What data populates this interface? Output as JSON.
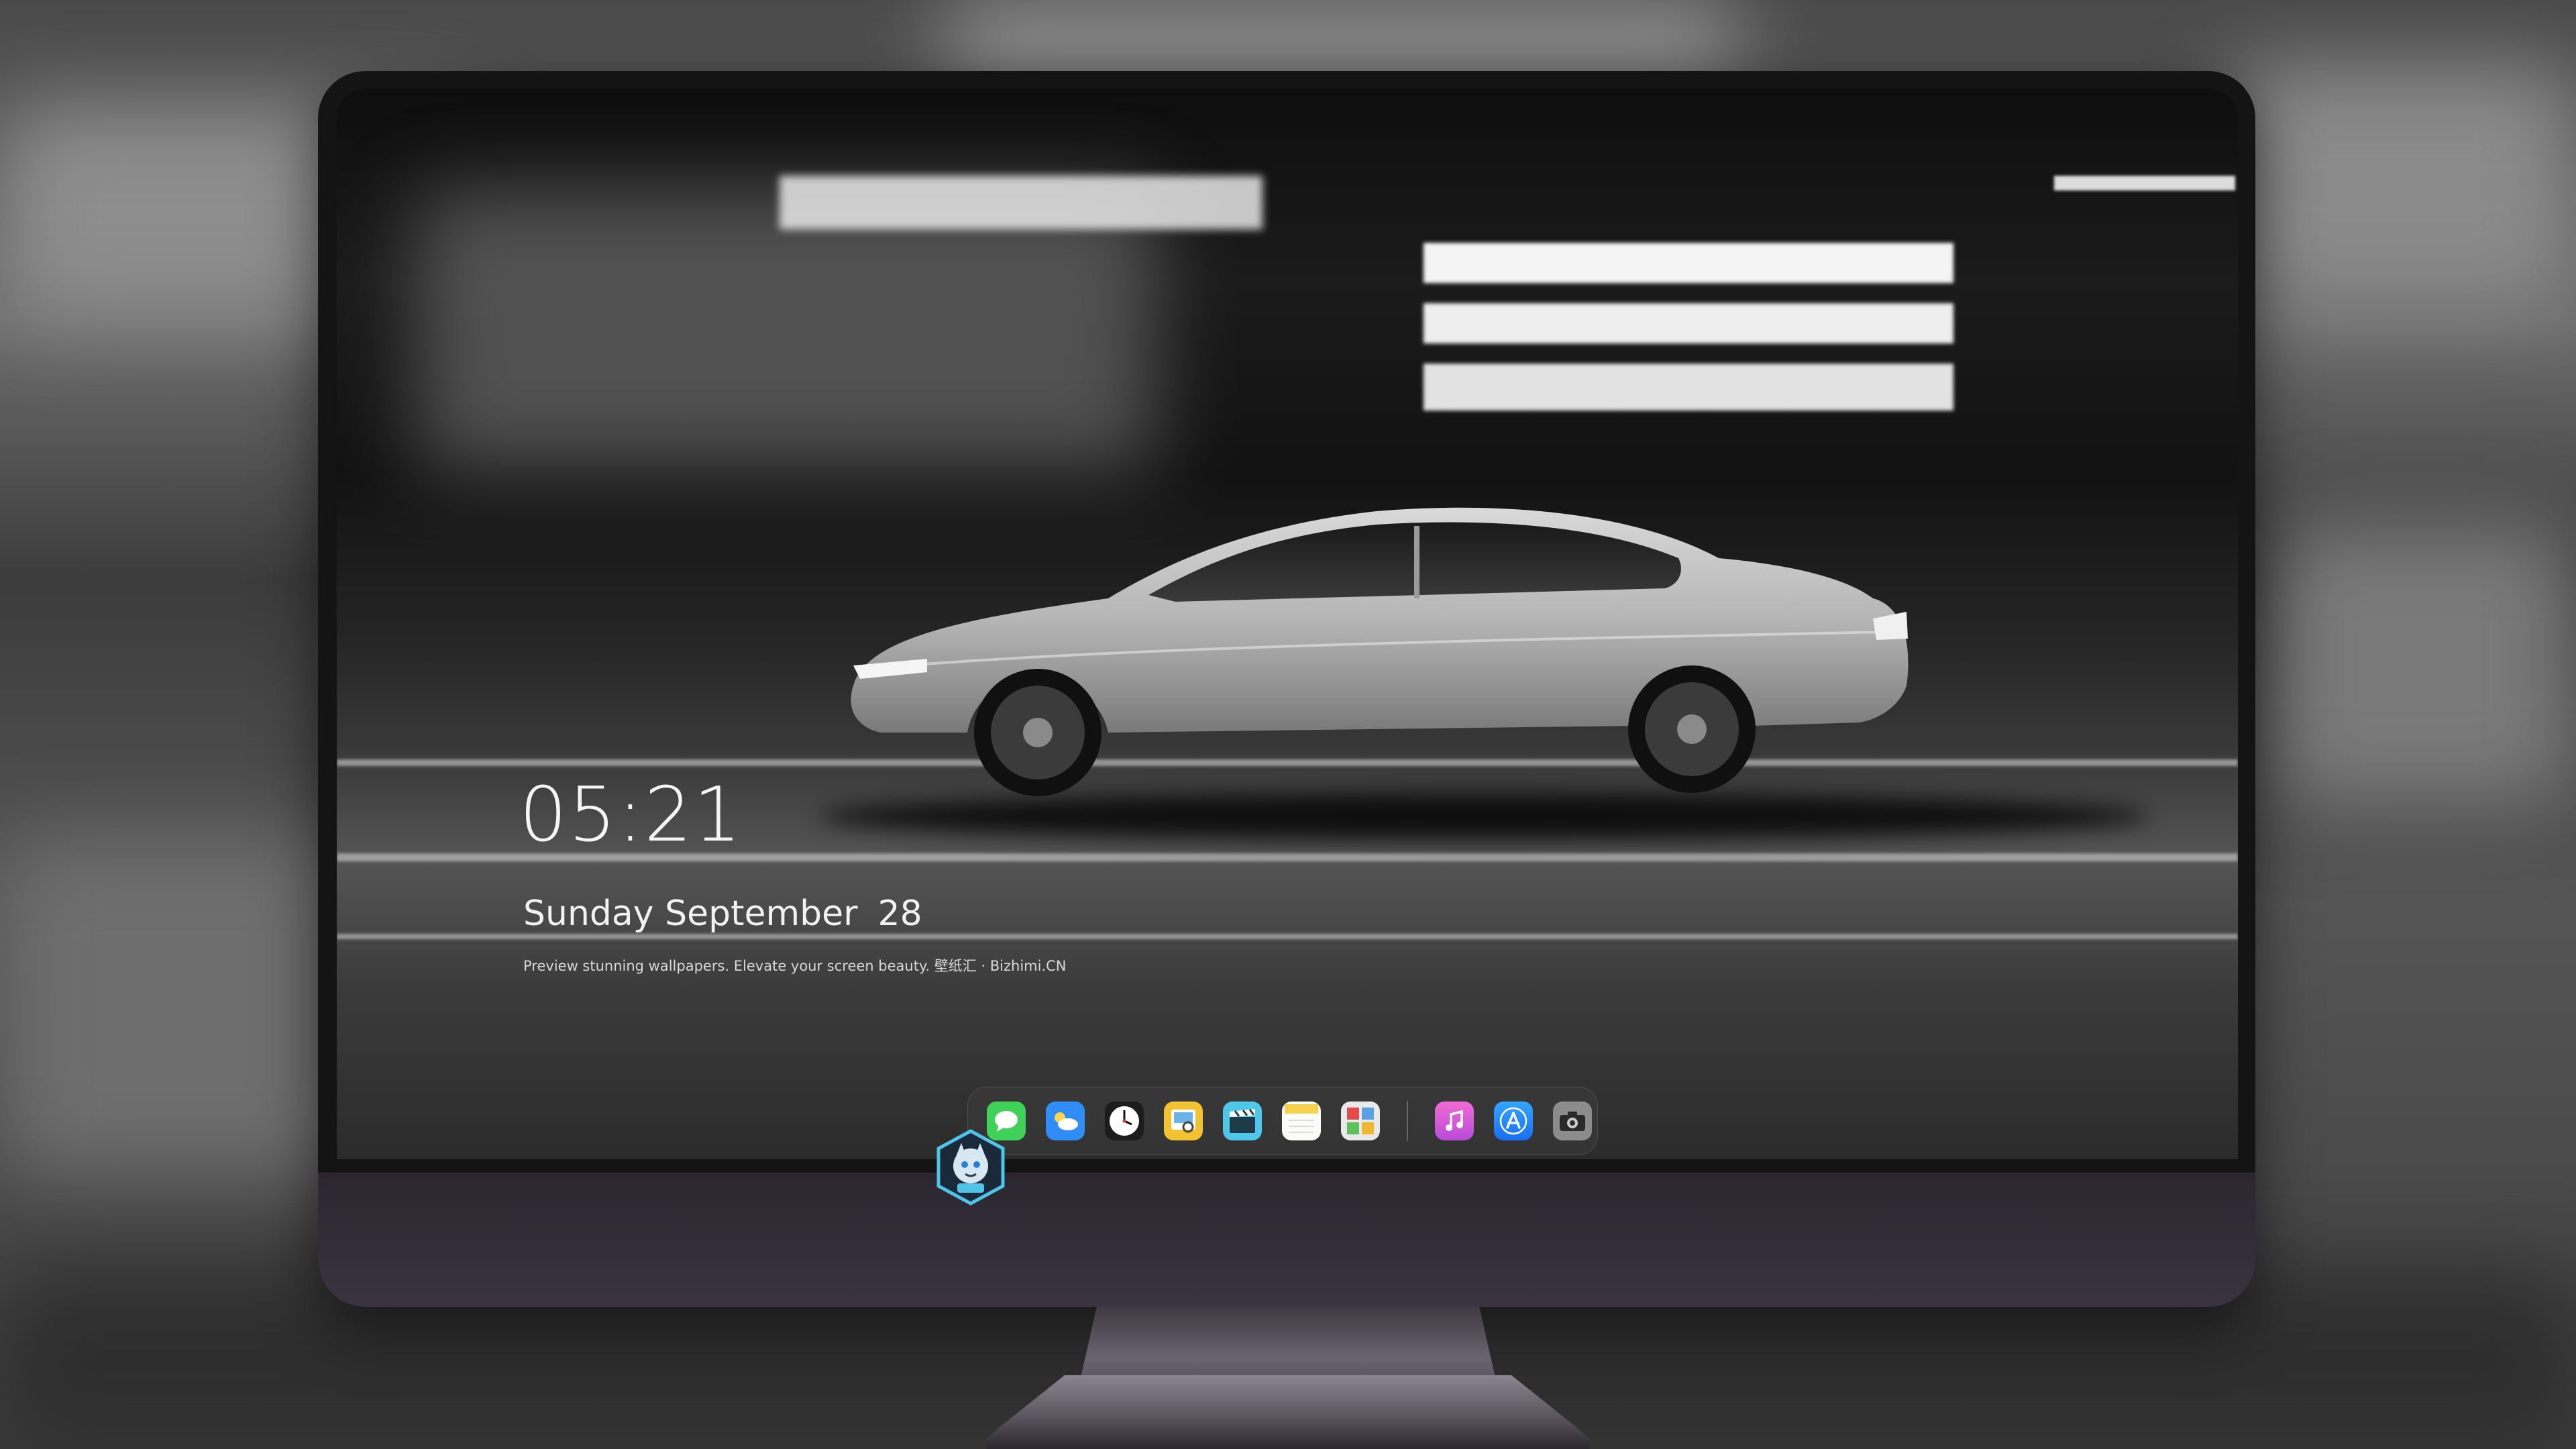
{
  "lock_screen": {
    "time": "05:21",
    "weekday_month": "Sunday September",
    "day": "28",
    "tagline": "Preview stunning wallpapers. Elevate your screen beauty. 壁纸汇 · Bizhimi.CN"
  },
  "dock": {
    "apps": [
      {
        "name": "Messages",
        "icon": "messages-icon",
        "color": "#3fd158"
      },
      {
        "name": "Weather",
        "icon": "weather-icon",
        "color": "#2f8df5"
      },
      {
        "name": "Clock",
        "icon": "clock-icon",
        "color": "#1c1c1c"
      },
      {
        "name": "Preview",
        "icon": "preview-icon",
        "color": "#f1c232"
      },
      {
        "name": "Clips",
        "icon": "clapperboard-icon",
        "color": "#4fc7e8"
      },
      {
        "name": "Notes",
        "icon": "notes-icon",
        "color": "#f7d24d"
      },
      {
        "name": "Photo Booth",
        "icon": "photo-booth-icon",
        "color": "#7fb2d8"
      },
      {
        "name": "iTunes",
        "icon": "itunes-icon",
        "color": "#e05bd6"
      },
      {
        "name": "App Store",
        "icon": "app-store-icon",
        "color": "#2b8ef6"
      },
      {
        "name": "Camera",
        "icon": "camera-icon",
        "color": "#8c8c8c"
      }
    ]
  },
  "colors": {
    "bezel": "#141414",
    "chin": "#332d38",
    "text": "#f5f5f5"
  }
}
